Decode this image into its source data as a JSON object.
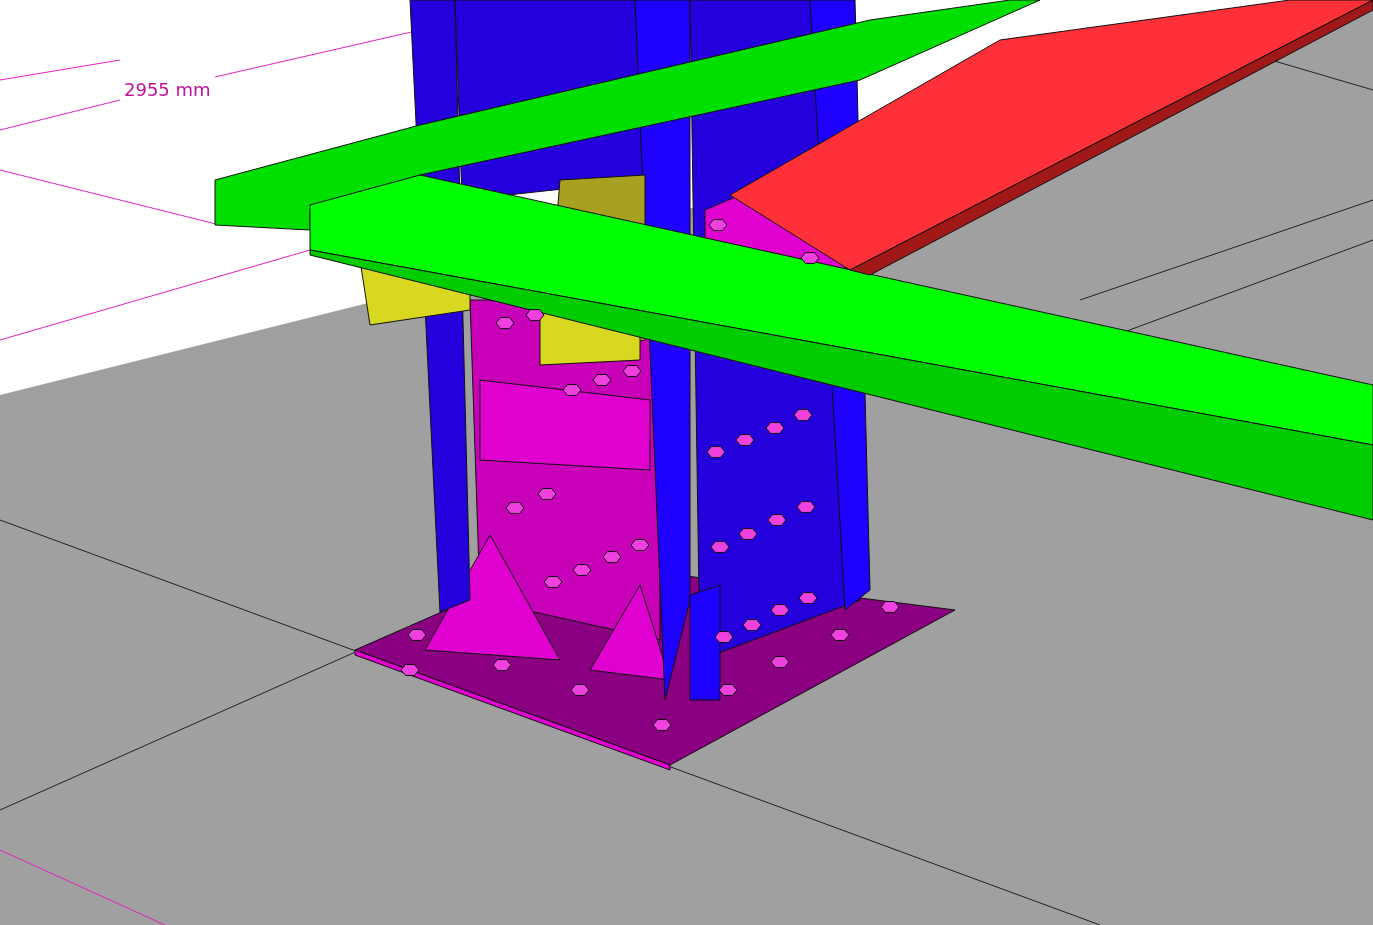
{
  "viewport": {
    "dimension_label": "2955 mm"
  }
}
